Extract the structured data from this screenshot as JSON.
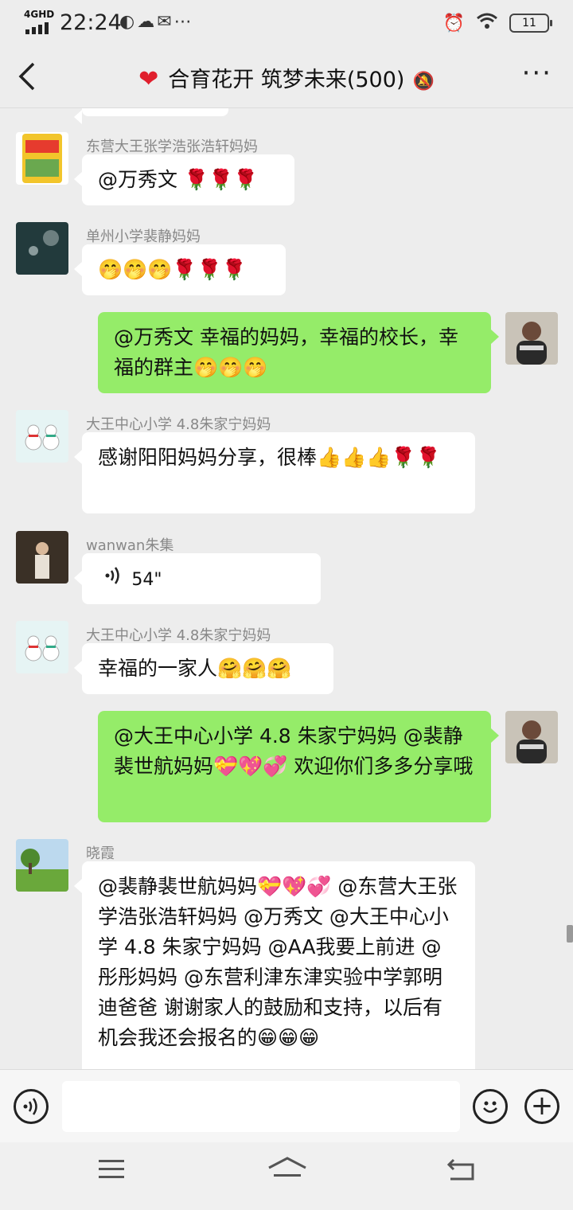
{
  "status_bar": {
    "network": "4GHD",
    "time": "22:24",
    "notification_icons": "◐☁✉⋯",
    "alarm_icon": "⏰",
    "wifi_icon": "◡",
    "battery": "11"
  },
  "header": {
    "heart": "❤",
    "title": "合育花开 筑梦未来(500)",
    "mute_icon": "🔕",
    "more": "···",
    "back": "‹"
  },
  "messages": [
    {
      "id": "m1",
      "direction": "in",
      "sender": "东营大王张学浩张浩轩妈妈",
      "text": "@万秀文 🌹🌹🌹",
      "avatar": "product-bag"
    },
    {
      "id": "m2",
      "direction": "in",
      "sender": "单州小学裴静妈妈",
      "text": "🤭🤭🤭🌹🌹🌹",
      "avatar": "night-photo"
    },
    {
      "id": "m3",
      "direction": "out",
      "text": "@万秀文  幸福的妈妈，幸福的校长，幸福的群主🤭🤭🤭",
      "avatar": "self-photo"
    },
    {
      "id": "m4",
      "direction": "in",
      "sender": "大王中心小学 4.8朱家宁妈妈",
      "text": "感谢阳阳妈妈分享，很棒👍👍👍🌹🌹",
      "avatar": "snowman"
    },
    {
      "id": "m5",
      "direction": "in",
      "sender": "wanwan朱集",
      "voice_duration": "54\"",
      "voice_icon": "◁))",
      "avatar": "portrait"
    },
    {
      "id": "m6",
      "direction": "in",
      "sender": "大王中心小学 4.8朱家宁妈妈",
      "text": "幸福的一家人🤗🤗🤗",
      "avatar": "snowman"
    },
    {
      "id": "m7",
      "direction": "out",
      "text": "@大王中心小学 4.8 朱家宁妈妈 @裴静裴世航妈妈💝💖💞 欢迎你们多多分享哦",
      "avatar": "self-photo"
    },
    {
      "id": "m8",
      "direction": "in",
      "sender": "晓霞",
      "text": "@裴静裴世航妈妈💝💖💞 @东营大王张学浩张浩轩妈妈 @万秀文 @大王中心小学 4.8 朱家宁妈妈 @AA我要上前进 @彤彤妈妈 @东营利津东津实验中学郭明迪爸爸  谢谢家人的鼓励和支持，以后有机会我还会报名的😁😁😁",
      "avatar": "meadow"
    }
  ],
  "input_bar": {
    "voice_icon": "◁))",
    "placeholder": "",
    "emoji_icon": "☺",
    "add_icon": "+"
  },
  "system_nav": {
    "menu": "≡",
    "home": "⌂",
    "back": "↩"
  }
}
